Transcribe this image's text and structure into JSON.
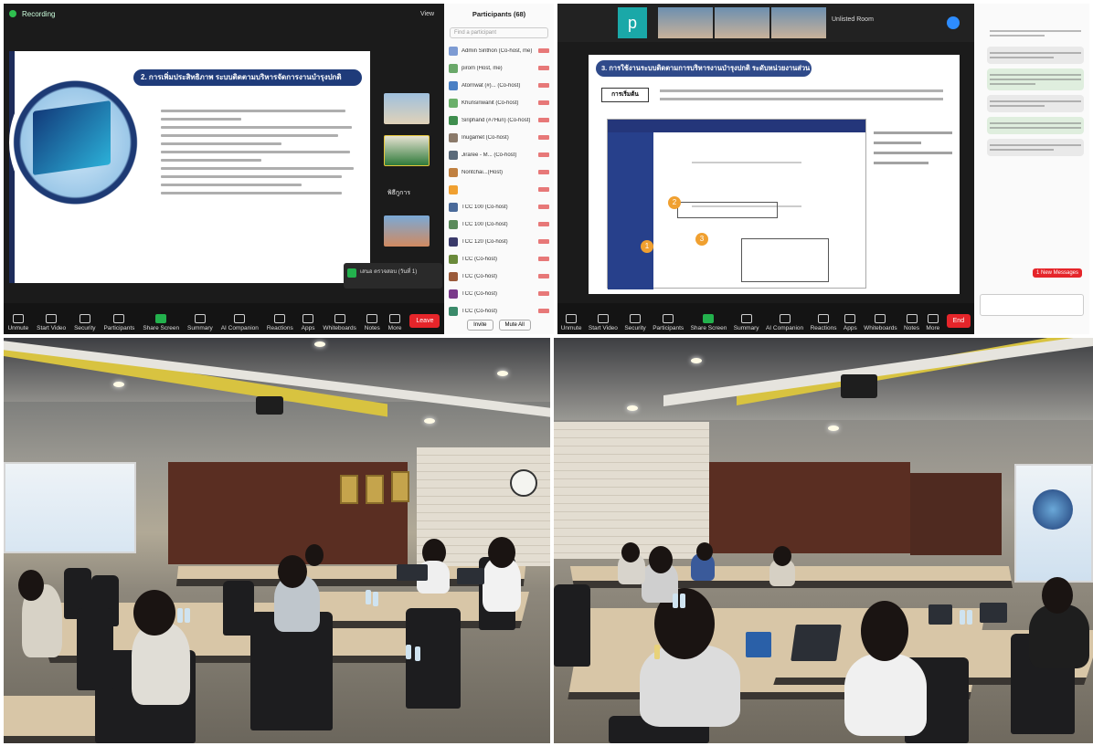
{
  "panel1": {
    "recording": "Recording",
    "view": "View",
    "slide_title": "2. การเพิ่มประสิทธิภาพ ระบบติดตามบริหารจัดการงานบำรุงปกติ",
    "side_group_label": "พิธีกูการ",
    "participants_title": "Participants (68)",
    "search_placeholder": "Find a participant",
    "participants": [
      {
        "name": "Admin Sirithon (Co-host, me)",
        "color": "#7d9bd3"
      },
      {
        "name": "pirom (Host, me)",
        "color": "#6aa86a"
      },
      {
        "name": "Atornwat (#)... (Co-host)",
        "color": "#4a80c4"
      },
      {
        "name": "Khunsiriwanit (Co-host)",
        "color": "#6ab06a"
      },
      {
        "name": "Siriphand (#7Hun) (Co-host)",
        "color": "#3f8e4e"
      },
      {
        "name": "Inugamet (Co-host)",
        "color": "#8b7a6a"
      },
      {
        "name": "Jiraree - M... (Co-host)",
        "color": "#5a6a7a"
      },
      {
        "name": "Nontchai...(Host)",
        "color": "#c08040"
      },
      {
        "name": "",
        "color": "#f0a030"
      },
      {
        "name": "TCC 100 (Co-host)",
        "color": "#4a6a9a"
      },
      {
        "name": "TCC 100 (Co-host)",
        "color": "#5a8a5a"
      },
      {
        "name": "TCC 120 (Co-host)",
        "color": "#3a3a6a"
      },
      {
        "name": "TCC (Co-host)",
        "color": "#6a8a3a"
      },
      {
        "name": "TCC (Co-host)",
        "color": "#9a5a3a"
      },
      {
        "name": "TCC (Co-host)",
        "color": "#7a3a8a"
      },
      {
        "name": "TCC (Co-host)",
        "color": "#3a8a6a"
      }
    ],
    "invite": "Invite",
    "mute_all": "Mute All",
    "chat_notice": "เสนอ ตรวจสอบ (วันที่ 1)",
    "toolbar": [
      "Unmute",
      "Start Video",
      "Security",
      "Participants",
      "Share Screen",
      "Summary",
      "AI Companion",
      "Reactions",
      "Apps",
      "Whiteboards",
      "Notes",
      "More"
    ],
    "leave": "Leave"
  },
  "panel2": {
    "logo_letter": "p",
    "slide_title": "3. การใช้งานระบบติดตามการบริหารงานบำรุงปกติ ระดับหน่วยงานส่วนกลาง",
    "tag": "การเริ่มต้น",
    "app_name": "Unlisted Room",
    "step_badges": [
      "1",
      "2",
      "3"
    ],
    "toolbar": [
      "Unmute",
      "Start Video",
      "Security",
      "Participants",
      "Share Screen",
      "Summary",
      "AI Companion",
      "Reactions",
      "Apps",
      "Whiteboards",
      "Notes",
      "More"
    ],
    "leave": "End",
    "new_messages": "1 New Messages"
  },
  "colors": {
    "zoom_bg": "#1b1b1b",
    "share_green": "#23b14d",
    "leave_red": "#e5252a",
    "slide_navy": "#1f3b7a"
  }
}
